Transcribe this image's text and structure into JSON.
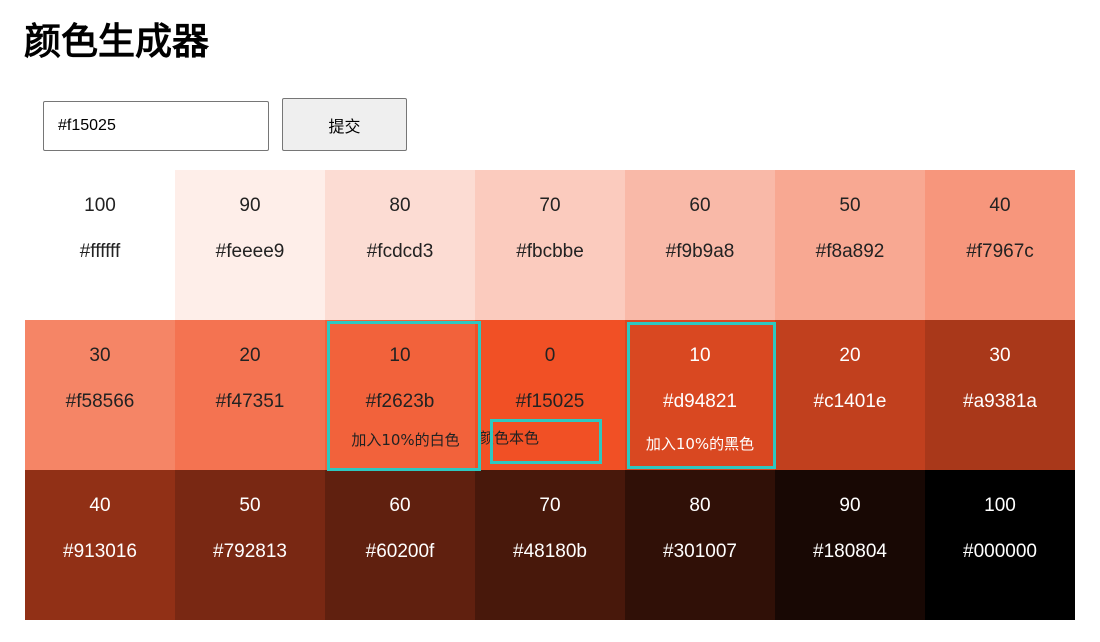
{
  "page": {
    "title": "颜色生成器"
  },
  "form": {
    "input_value": "#f15025",
    "submit_label": "提交"
  },
  "swatches": [
    {
      "weight": "100",
      "hex": "#ffffff",
      "text_color": "#222222"
    },
    {
      "weight": "90",
      "hex": "#feeee9",
      "text_color": "#222222"
    },
    {
      "weight": "80",
      "hex": "#fcdcd3",
      "text_color": "#222222"
    },
    {
      "weight": "70",
      "hex": "#fbcbbe",
      "text_color": "#222222"
    },
    {
      "weight": "60",
      "hex": "#f9b9a8",
      "text_color": "#222222"
    },
    {
      "weight": "50",
      "hex": "#f8a892",
      "text_color": "#222222"
    },
    {
      "weight": "40",
      "hex": "#f7967c",
      "text_color": "#222222"
    },
    {
      "weight": "30",
      "hex": "#f58566",
      "text_color": "#222222"
    },
    {
      "weight": "20",
      "hex": "#f47351",
      "text_color": "#222222"
    },
    {
      "weight": "10",
      "hex": "#f2623b",
      "text_color": "#222222",
      "note": "加入10%的白色"
    },
    {
      "weight": "0",
      "hex": "#f15025",
      "text_color": "#222222",
      "note": "颜色本色"
    },
    {
      "weight": "10",
      "hex": "#d94821",
      "text_color": "#ffffff",
      "note": "加入10%的黑色"
    },
    {
      "weight": "20",
      "hex": "#c1401e",
      "text_color": "#ffffff"
    },
    {
      "weight": "30",
      "hex": "#a9381a",
      "text_color": "#ffffff"
    },
    {
      "weight": "40",
      "hex": "#913016",
      "text_color": "#ffffff"
    },
    {
      "weight": "50",
      "hex": "#792813",
      "text_color": "#ffffff"
    },
    {
      "weight": "60",
      "hex": "#60200f",
      "text_color": "#ffffff"
    },
    {
      "weight": "70",
      "hex": "#48180b",
      "text_color": "#ffffff"
    },
    {
      "weight": "80",
      "hex": "#301007",
      "text_color": "#ffffff"
    },
    {
      "weight": "90",
      "hex": "#180804",
      "text_color": "#ffffff"
    },
    {
      "weight": "100",
      "hex": "#000000",
      "text_color": "#ffffff"
    }
  ],
  "colors": {
    "highlight_border": "#2ec8c0",
    "base_color": "#f15025"
  }
}
